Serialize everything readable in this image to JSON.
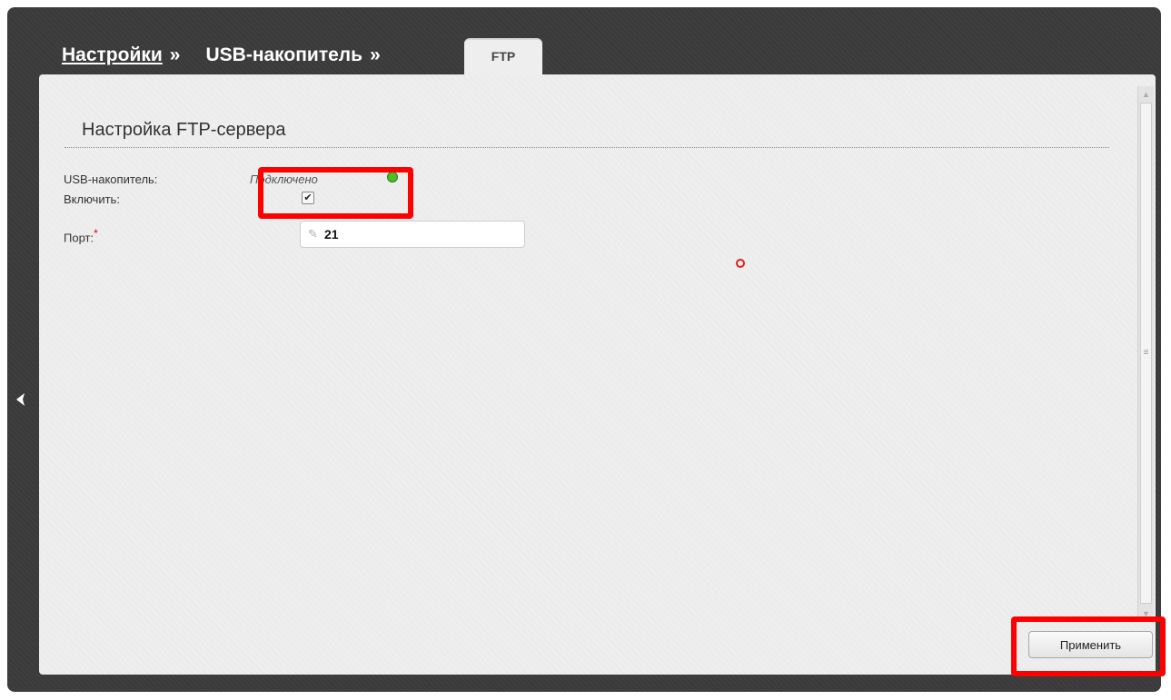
{
  "breadcrumb": {
    "settings_label": "Настройки",
    "separator": "»",
    "usb_label": "USB-накопитель",
    "active_tab_label": "FTP"
  },
  "section": {
    "title": "Настройка FTP-сервера"
  },
  "form": {
    "usb_label": "USB-накопитель:",
    "usb_status": "Подключено",
    "enable_label": "Включить:",
    "enable_checked": true,
    "port_label": "Порт:",
    "port_required_mark": "*",
    "port_value": "21"
  },
  "actions": {
    "apply_label": "Применить"
  },
  "colors": {
    "highlight": "#ff0000",
    "status_ok": "#4cc02a"
  }
}
